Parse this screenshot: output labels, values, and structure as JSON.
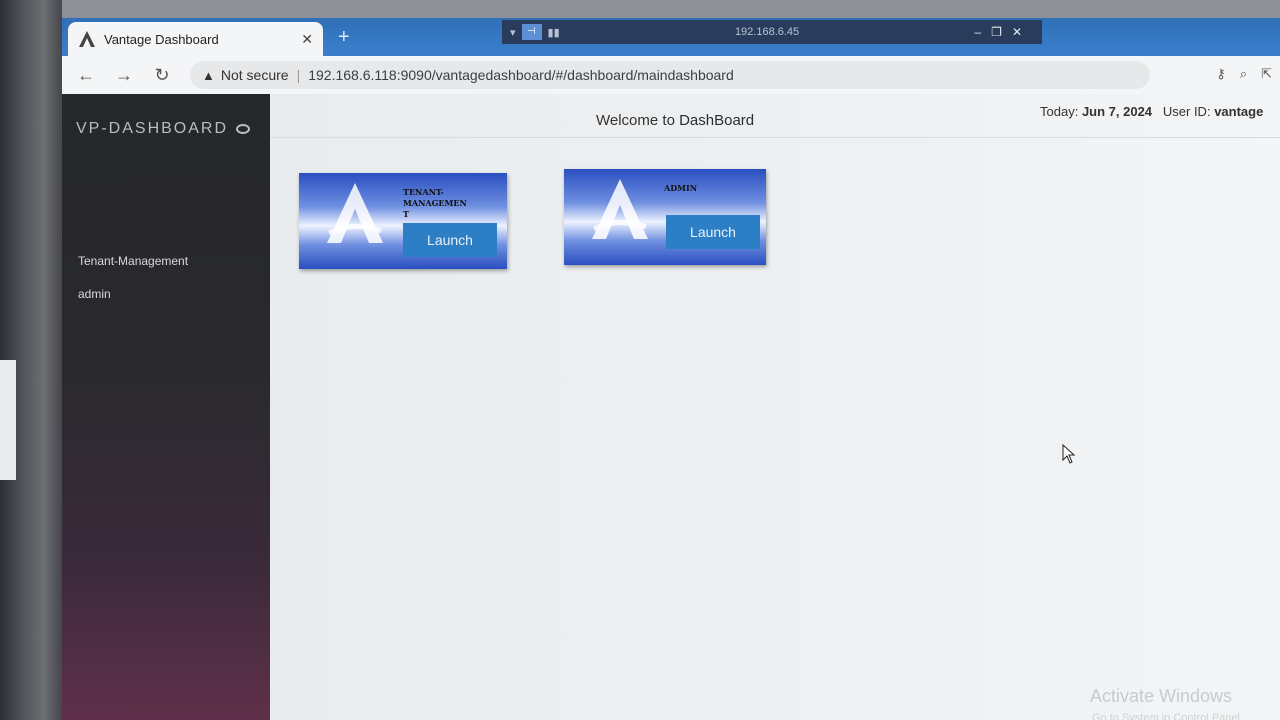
{
  "browser": {
    "tab_title": "Vantage Dashboard",
    "new_tab": "+",
    "security_label": "Not secure",
    "url": "192.168.6.118:9090/vantagedashboard/#/dashboard/maindashboard"
  },
  "remote": {
    "ip": "192.168.6.45"
  },
  "sidebar": {
    "brand": "VP-DASHBOARD",
    "items": [
      {
        "label": "Tenant-Management"
      },
      {
        "label": "admin"
      }
    ]
  },
  "header": {
    "welcome_prefix": "Welcome to",
    "welcome_name": "DashBoard",
    "today_label": "Today:",
    "today_value": "Jun 7, 2024",
    "user_label": "User ID:",
    "user_value": "vantage"
  },
  "cards": [
    {
      "title": "TENANT-\nMANAGEMEN\nT",
      "button": "Launch"
    },
    {
      "title": "ADMIN",
      "button": "Launch"
    }
  ],
  "overlay": {
    "activate_title": "Activate Windows",
    "activate_sub": "Go to System in Control Panel"
  },
  "colors": {
    "card_blue": "#2a4fc0",
    "launch_button": "#2c7fc4",
    "sidebar_dark": "#262728"
  }
}
